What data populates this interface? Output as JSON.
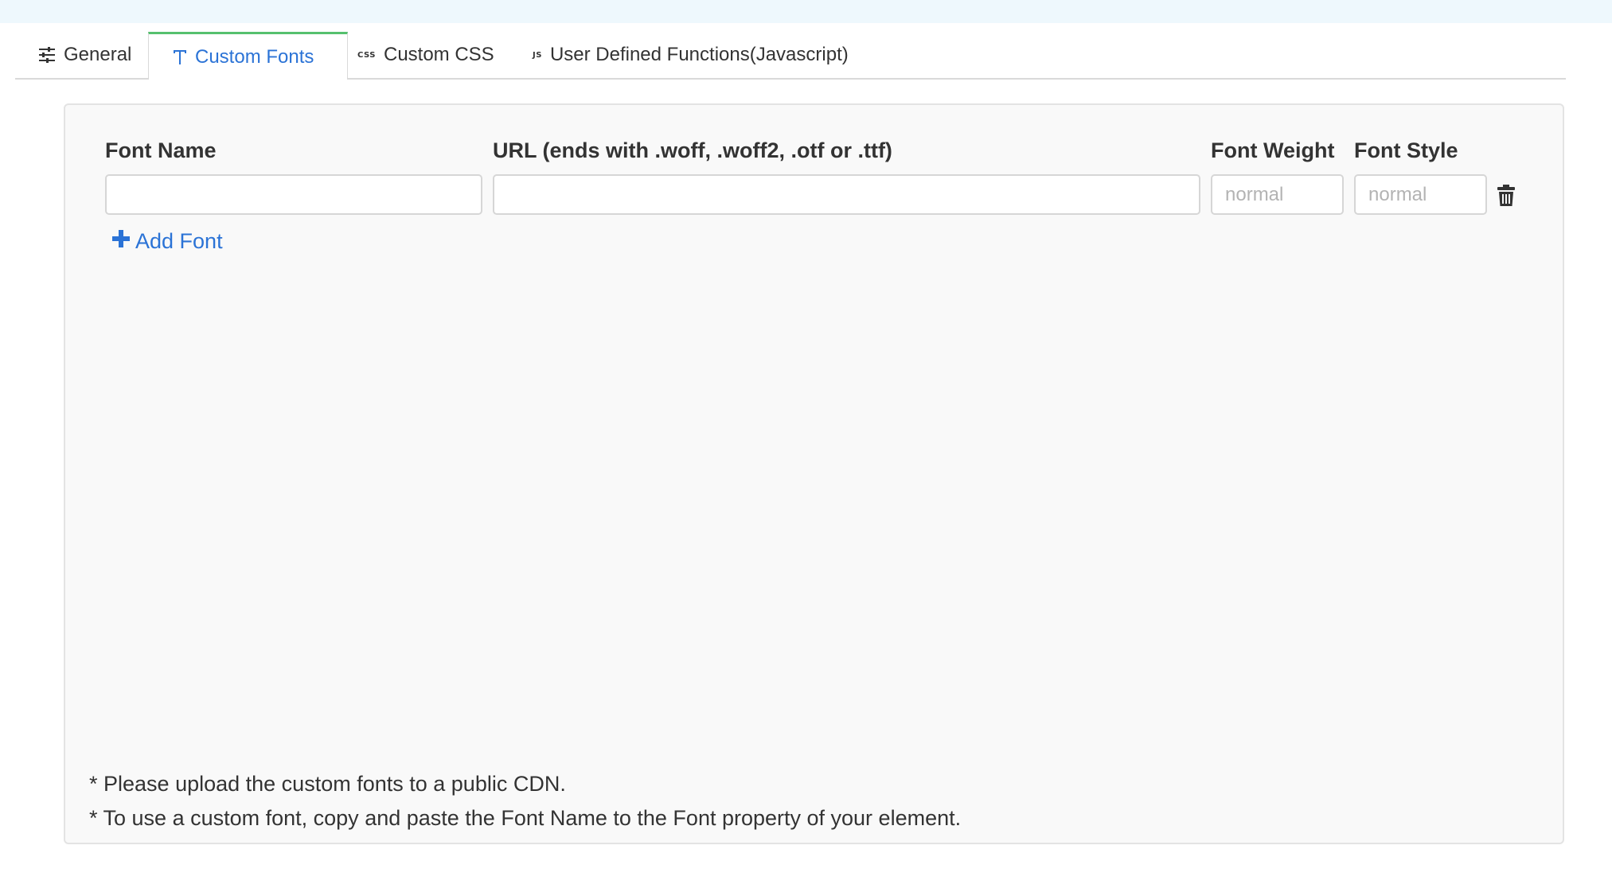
{
  "tabs": {
    "general": "General",
    "custom_fonts": "Custom Fonts",
    "custom_css": "Custom CSS",
    "user_functions": "User Defined Functions(Javascript)",
    "active": "custom_fonts",
    "css_icon_text": "CSS",
    "js_icon_text": "JS"
  },
  "columns": {
    "font_name": "Font Name",
    "url": "URL (ends with .woff, .woff2, .otf or .ttf)",
    "font_weight": "Font Weight",
    "font_style": "Font Style"
  },
  "font_row": {
    "font_name_value": "",
    "url_value": "",
    "font_weight_placeholder": "normal",
    "font_style_placeholder": "normal"
  },
  "add_font_label": "Add Font",
  "notes": [
    "* Please upload the custom fonts to a public CDN.",
    "* To use a custom font, copy and paste the Font Name to the Font property of your element."
  ],
  "icons": {
    "general": "sliders-icon",
    "custom_fonts": "text-t-icon",
    "custom_css": "css-icon",
    "user_functions": "js-icon",
    "add_font": "plus-icon",
    "delete_row": "trash-icon"
  },
  "colors": {
    "accent_blue": "#2b73d6",
    "active_tab_border": "#55c06e",
    "top_strip": "#eef8fd",
    "panel_bg": "#f9f9f9"
  }
}
